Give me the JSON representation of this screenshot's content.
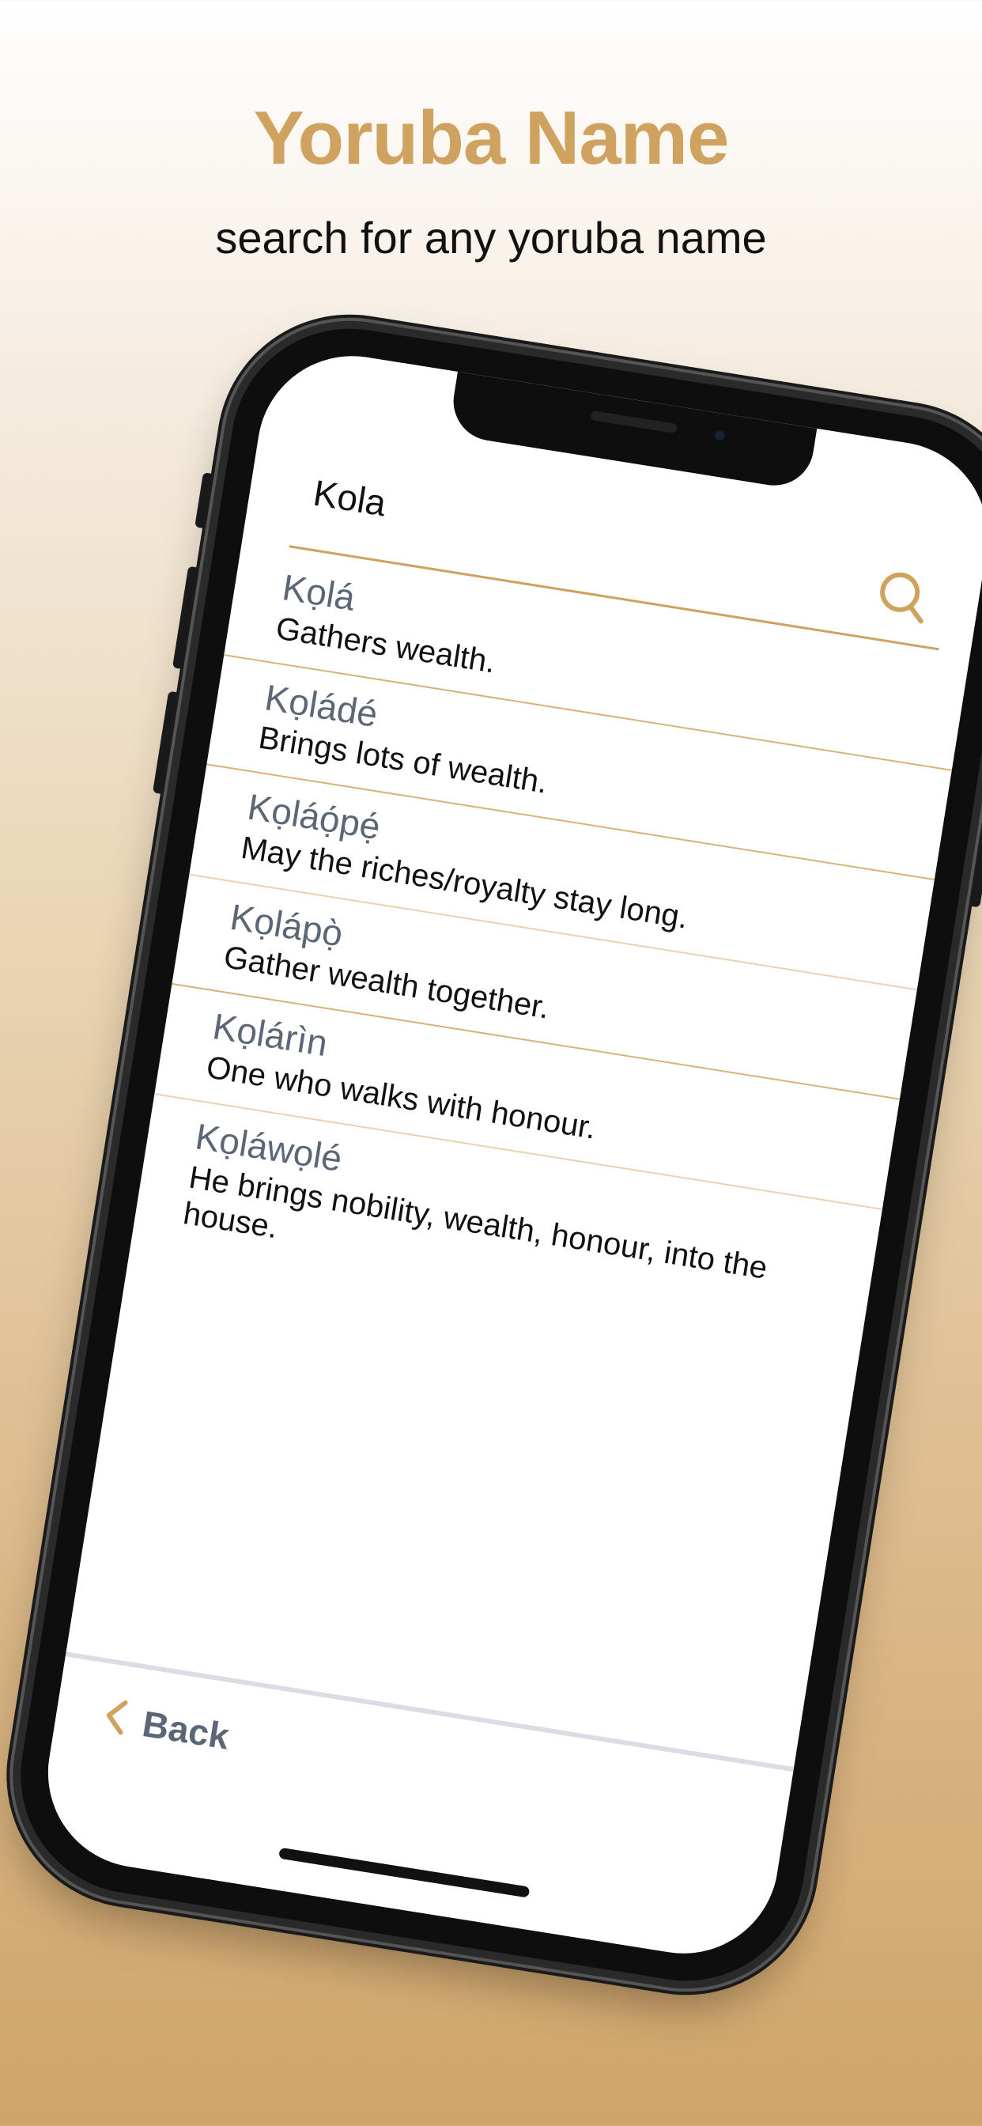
{
  "promo": {
    "title": "Yoruba Name",
    "subtitle": "search for any yoruba name"
  },
  "search": {
    "value": "Kola",
    "icon": "search-icon"
  },
  "results": [
    {
      "name": "Kọlá",
      "meaning": "Gathers wealth."
    },
    {
      "name": "Kọládé",
      "meaning": "Brings lots of wealth."
    },
    {
      "name": "Kọláọ́pẹ́",
      "meaning": "May the riches/royalty stay long."
    },
    {
      "name": "Kọlápọ̀",
      "meaning": "Gather wealth together."
    },
    {
      "name": "Kọlárìn",
      "meaning": "One who walks with honour."
    },
    {
      "name": "Kọláwọlé",
      "meaning": "He brings nobility, wealth, honour, into the house."
    }
  ],
  "nav": {
    "back_label": "Back",
    "back_icon": "chevron-left-icon"
  },
  "colors": {
    "accent": "#cfa25f",
    "name_text": "#5b6677"
  }
}
